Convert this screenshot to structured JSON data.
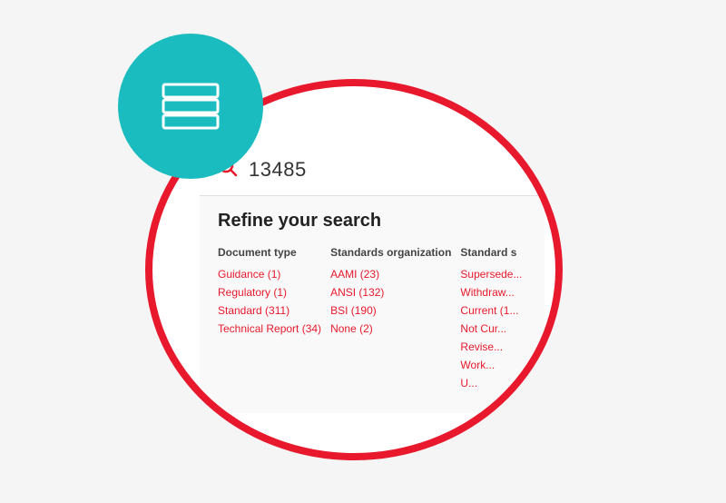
{
  "tealCircle": {
    "ariaLabel": "Layers icon"
  },
  "search": {
    "query": "13485",
    "searchIconLabel": "search"
  },
  "refine": {
    "title": "Refine your search",
    "columns": [
      {
        "header": "Document type",
        "items": [
          "Guidance (1)",
          "Regulatory (1)",
          "Standard (311)",
          "Technical Report (34)"
        ]
      },
      {
        "header": "Standards organization",
        "items": [
          "AAMI (23)",
          "ANSI (132)",
          "BSI (190)",
          "None (2)"
        ]
      },
      {
        "header": "Standard s",
        "items": [
          "Supersede...",
          "Withdraw...",
          "Current (1...",
          "Not Cur...",
          "Revise...",
          "Work...",
          "U..."
        ]
      }
    ]
  }
}
